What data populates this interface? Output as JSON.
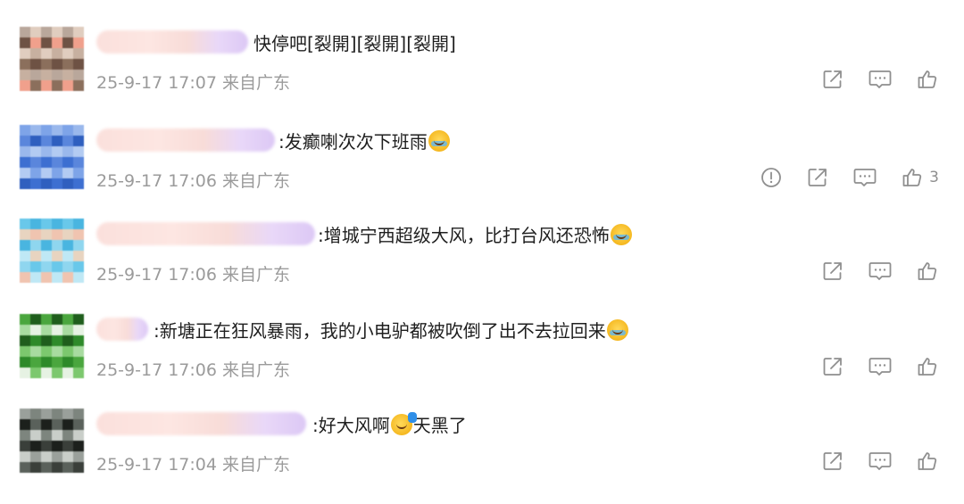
{
  "comments": [
    {
      "text": "快停吧[裂開][裂開][裂開]",
      "emoji_after": "",
      "text_after": "",
      "meta": "25-9-17 17:07 来自广东",
      "actions": [
        "share-icon",
        "comment-icon",
        "like-icon"
      ],
      "like_count": "",
      "avatar_colors": [
        "#b9a79b",
        "#8b6f5c",
        "#c7b0a0",
        "#6e5244",
        "#e0cdbf",
        "#f0a08c"
      ]
    },
    {
      "text": ":发癫喇次次下班雨",
      "emoji_after": "crying-face-emoji",
      "text_after": "",
      "meta": "25-9-17 17:06 来自广东",
      "actions": [
        "report-icon",
        "share-icon",
        "comment-icon",
        "like-icon"
      ],
      "like_count": "3",
      "avatar_colors": [
        "#7ea4e8",
        "#3d6fd1",
        "#b3cbf2",
        "#5a86dc",
        "#9ab8ec",
        "#2f5fbf"
      ]
    },
    {
      "text": ":增城宁西超级大风，比打台风还恐怖",
      "emoji_after": "crying-face-emoji",
      "text_after": "",
      "meta": "25-9-17 17:06 来自广东",
      "actions": [
        "share-icon",
        "comment-icon",
        "like-icon"
      ],
      "like_count": "",
      "avatar_colors": [
        "#69c8ea",
        "#bfe8f5",
        "#8fd6ef",
        "#e8d4c0",
        "#49b5e0",
        "#f0c4b0"
      ]
    },
    {
      "text": ":新塘正在狂风暴雨，我的小电驴都被吹倒了出不去拉回来",
      "emoji_after": "crying-face-emoji",
      "text_after": "",
      "meta": "25-9-17 17:06 来自广东",
      "actions": [
        "share-icon",
        "comment-icon",
        "like-icon"
      ],
      "like_count": "",
      "avatar_colors": [
        "#4aa63e",
        "#7cc86e",
        "#2e8a2a",
        "#a8dba0",
        "#1f5e1c",
        "#e6f2e3"
      ]
    },
    {
      "text": ":好大风啊",
      "emoji_after": "waving-hand-emoji",
      "text_after": "天黑了",
      "meta": "25-9-17 17:04 来自广东",
      "actions": [
        "share-icon",
        "comment-icon",
        "like-icon"
      ],
      "like_count": "",
      "avatar_colors": [
        "#9aa09b",
        "#3a3f3a",
        "#c9cec9",
        "#1c201c",
        "#7d857e",
        "#5a615b"
      ]
    }
  ]
}
